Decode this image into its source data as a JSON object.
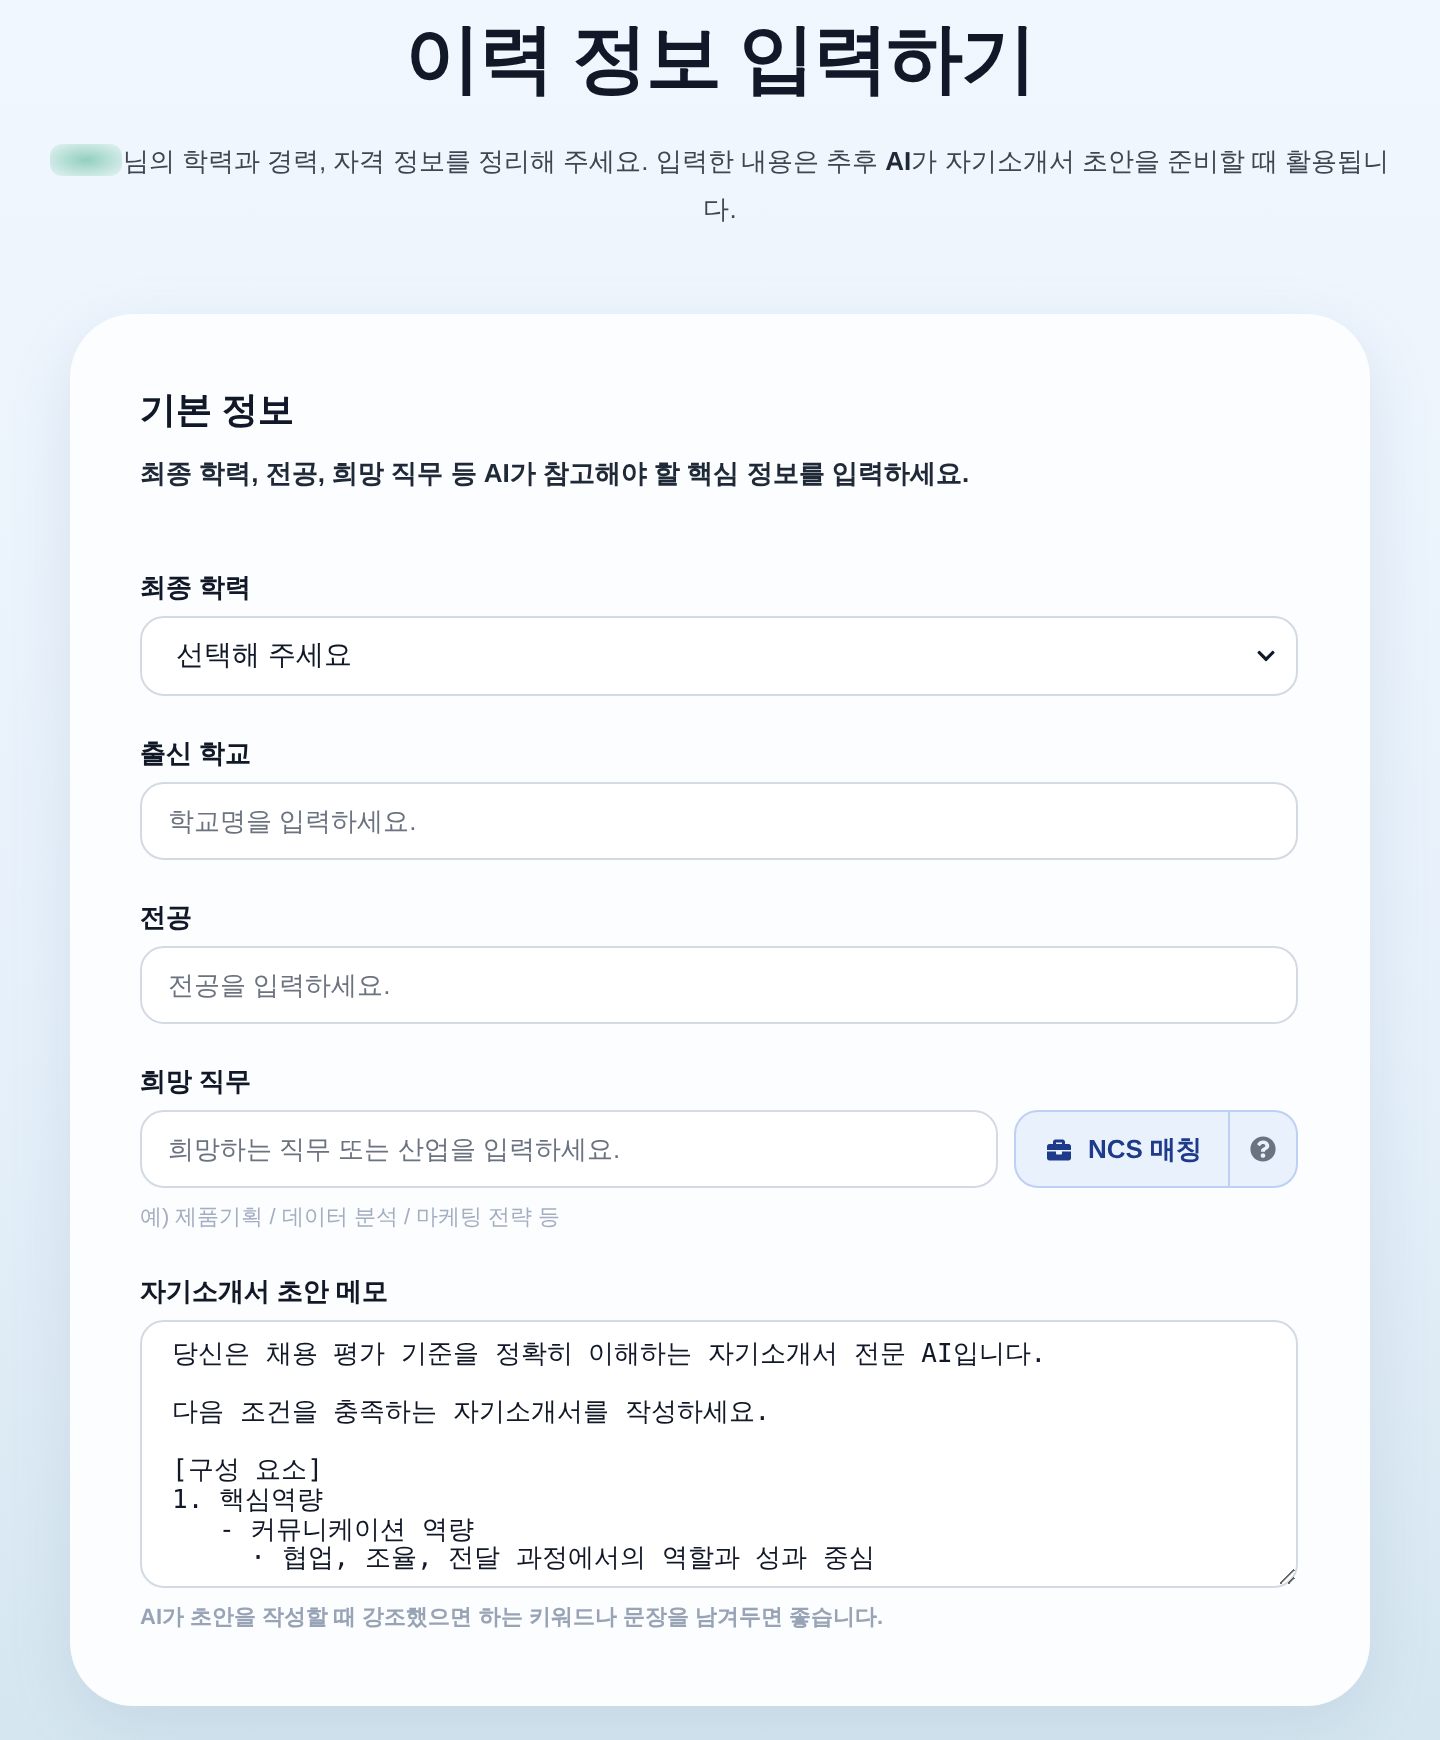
{
  "header": {
    "title": "이력 정보 입력하기",
    "name_blurred": true,
    "subtitle": "님의 학력과 경력, 자격 정보를 정리해 주세요. 입력한 내용은 추후 **AI**가 자기소개서 초안을 준비할 때 활용됩니다."
  },
  "section": {
    "title": "기본 정보",
    "description": "최종 학력, 전공, 희망 직무 등 **AI**가 참고해야 할 핵심 정보를 입력하세요."
  },
  "fields": [
    {
      "kind": "select",
      "label": "최종 학력",
      "value": "선택해 주세요"
    },
    {
      "kind": "text",
      "label": "출신 학교",
      "placeholder": "학교명을 입력하세요."
    },
    {
      "kind": "text",
      "label": "전공",
      "placeholder": "전공을 입력하세요."
    },
    {
      "kind": "text_with_actions",
      "label": "희망 직무",
      "placeholder": "희망하는 직무 또는 산업을 입력하세요.",
      "action": "NCS 매칭",
      "hint": "예) 제품기획 / 데이터 분석 / 마케팅 전략 등"
    },
    {
      "kind": "textarea",
      "label": "자기소개서 초안 메모",
      "value": "당신은 채용 평가 기준을 정확히 이해하는 자기소개서 전문 AI입니다.\n\n다음 조건을 충족하는 자기소개서를 작성하세요.\n\n[구성 요소]\n1. 핵심역량\n   - 커뮤니케이션 역량\n     · 협업, 조율, 전달 과정에서의 역할과 성과 중심",
      "hint": "**AI**가 초안을 작성할 때 강조했으면 하는 키워드나 문장을 남겨두면 좋습니다."
    }
  ]
}
